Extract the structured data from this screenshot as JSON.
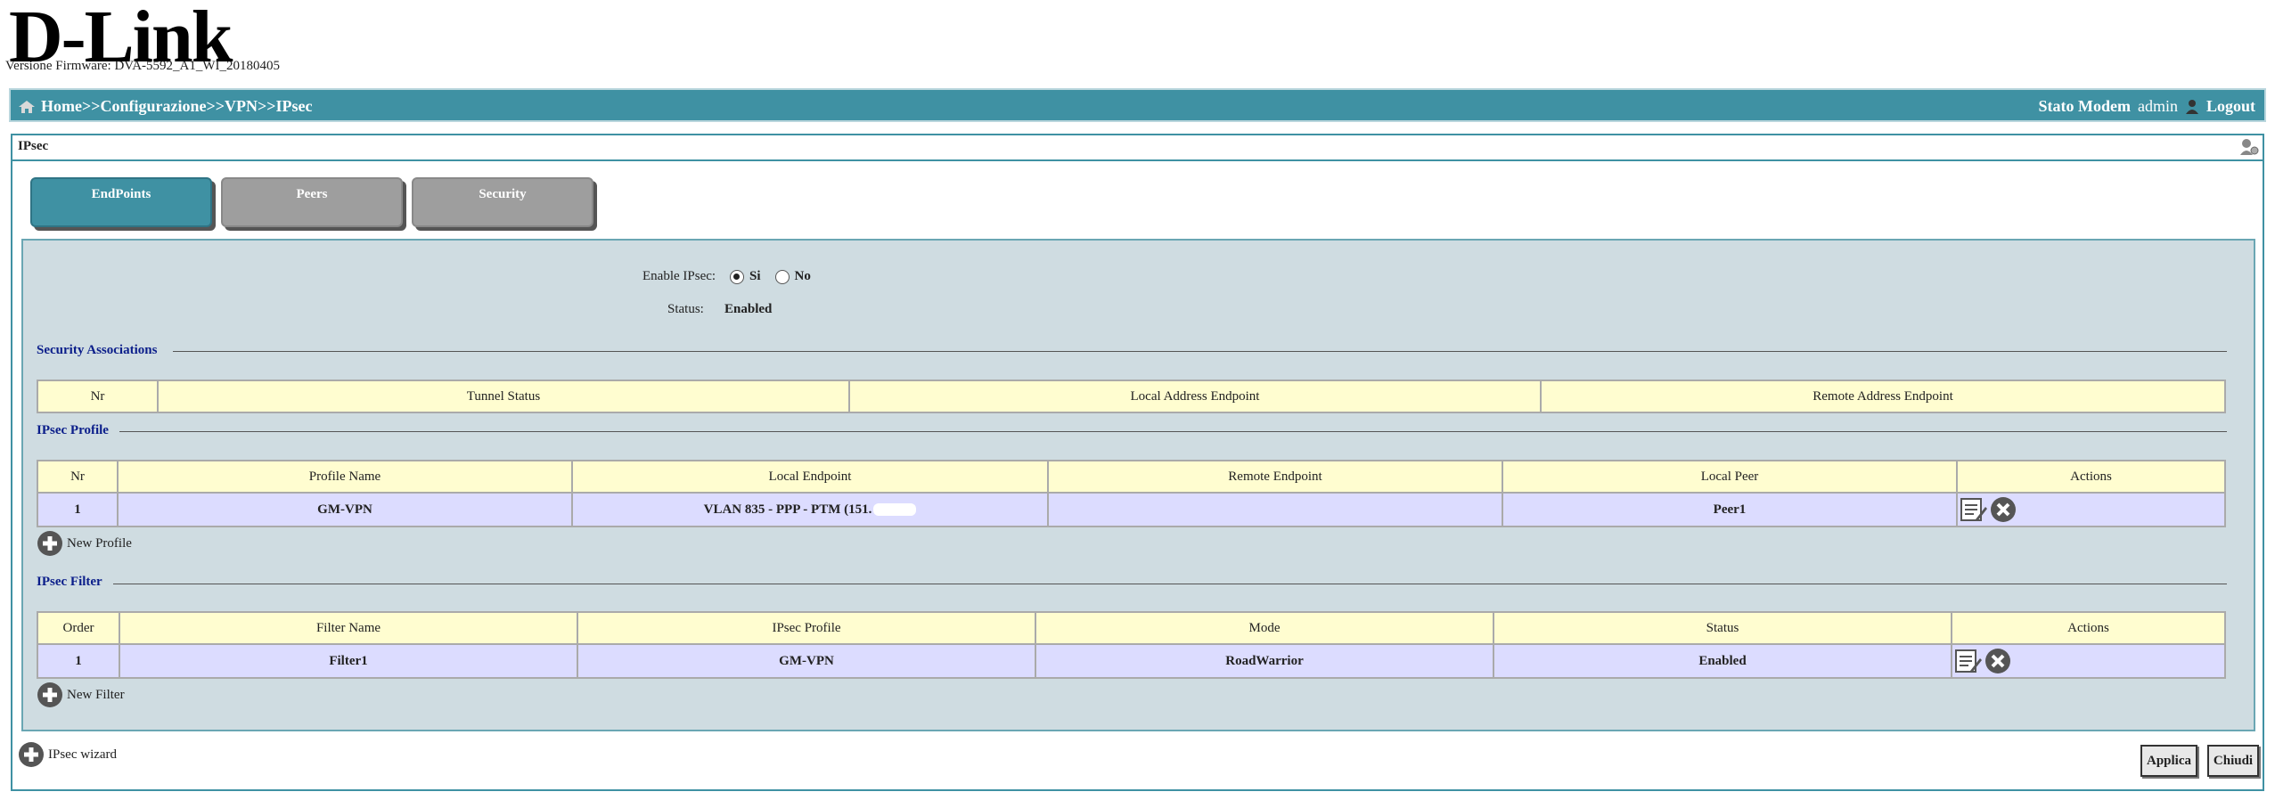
{
  "brand": {
    "logo": "D-Link",
    "registered": "®"
  },
  "firmware": "Versione Firmware: DVA-5592_A1_WI_20180405",
  "topbar": {
    "breadcrumb": [
      "Home",
      ">>",
      "Configurazione",
      ">>",
      "VPN",
      ">>",
      "IPsec"
    ],
    "stato_modem": "Stato Modem",
    "user": "admin",
    "logout": "Logout"
  },
  "panel": {
    "title": "IPsec"
  },
  "tabs": [
    {
      "label": "EndPoints",
      "active": true
    },
    {
      "label": "Peers",
      "active": false
    },
    {
      "label": "Security",
      "active": false
    }
  ],
  "form": {
    "enable_label": "Enable IPsec:",
    "opt_yes": "Si",
    "opt_no": "No",
    "selected": "Si",
    "status_label": "Status:",
    "status_value": "Enabled"
  },
  "security_associations": {
    "title": "Security Associations",
    "columns": [
      "Nr",
      "Tunnel Status",
      "Local Address Endpoint",
      "Remote Address Endpoint"
    ]
  },
  "ipsec_profile": {
    "title": "IPsec Profile",
    "columns": [
      "Nr",
      "Profile Name",
      "Local Endpoint",
      "Remote Endpoint",
      "Local Peer",
      "Actions"
    ],
    "rows": [
      {
        "nr": "1",
        "name": "GM-VPN",
        "local": "VLAN 835 - PPP - PTM (151.",
        "remote": "",
        "peer": "Peer1"
      }
    ],
    "add_label": "New Profile"
  },
  "ipsec_filter": {
    "title": "IPsec Filter",
    "columns": [
      "Order",
      "Filter Name",
      "IPsec Profile",
      "Mode",
      "Status",
      "Actions"
    ],
    "rows": [
      {
        "order": "1",
        "name": "Filter1",
        "profile": "GM-VPN",
        "mode": "RoadWarrior",
        "status": "Enabled"
      }
    ],
    "add_label": "New Filter"
  },
  "wizard_label": "IPsec wizard",
  "buttons": {
    "apply": "Applica",
    "close": "Chiudi"
  },
  "colors": {
    "header": "#3f91a3",
    "table_header": "#fffdd0",
    "table_row": "#dcdcff",
    "inner_bg": "#cfdce1"
  }
}
